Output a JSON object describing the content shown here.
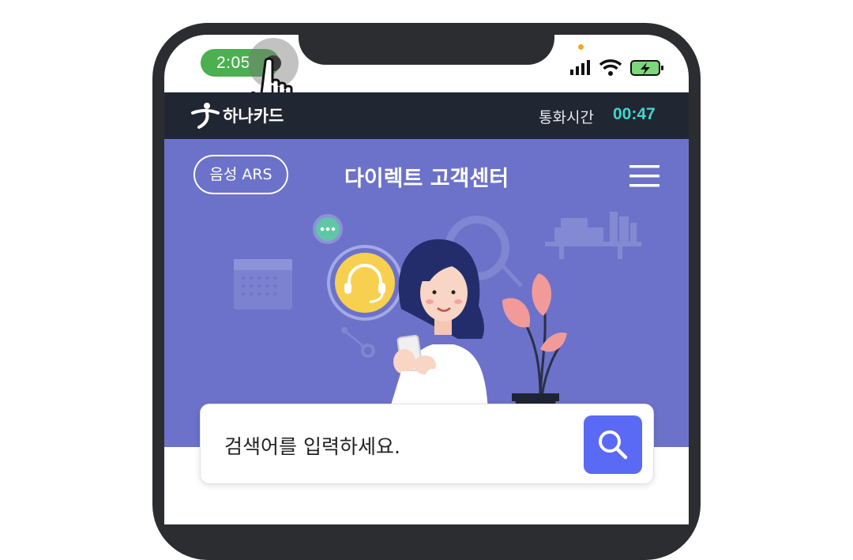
{
  "status_bar": {
    "time": "2:05",
    "icons": [
      "signal-icon",
      "wifi-icon",
      "battery-charging-icon"
    ],
    "pill_color": "#4caf50"
  },
  "topbar": {
    "brand": "하나카드",
    "call_label": "통화시간",
    "call_time": "00:47",
    "accent": "#3ed6d0"
  },
  "hero": {
    "ars_button": "음성 ARS",
    "title": "다이렉트 고객센터",
    "menu_icon": "hamburger-menu-icon",
    "background": "#6c72c9"
  },
  "search": {
    "placeholder": "검색어를 입력하세요.",
    "button_icon": "search-icon",
    "button_color": "#5a6af4"
  }
}
